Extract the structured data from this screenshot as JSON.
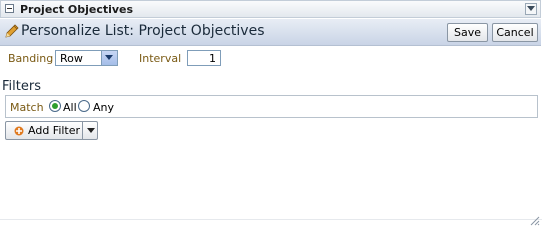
{
  "window": {
    "title": "Project Objectives"
  },
  "header": {
    "heading": "Personalize List: Project Objectives",
    "save_label": "Save",
    "cancel_label": "Cancel"
  },
  "options": {
    "banding_label": "Banding",
    "banding_value": "Row",
    "interval_label": "Interval",
    "interval_value": "1"
  },
  "filters": {
    "title": "Filters",
    "match_label": "Match",
    "all_label": "All",
    "any_label": "Any",
    "selected": "All",
    "add_filter_label": "Add Filter"
  },
  "colors": {
    "header_gradient_top": "#e8edf5",
    "header_gradient_bottom": "#c9d4e6",
    "label_color": "#7a5a14",
    "radio_selected": "#2e9e2e"
  },
  "icons": [
    "collapse-icon",
    "menu-dropdown-icon",
    "pencil-icon",
    "add-icon",
    "dropdown-arrow-icon",
    "resize-grip-icon"
  ]
}
